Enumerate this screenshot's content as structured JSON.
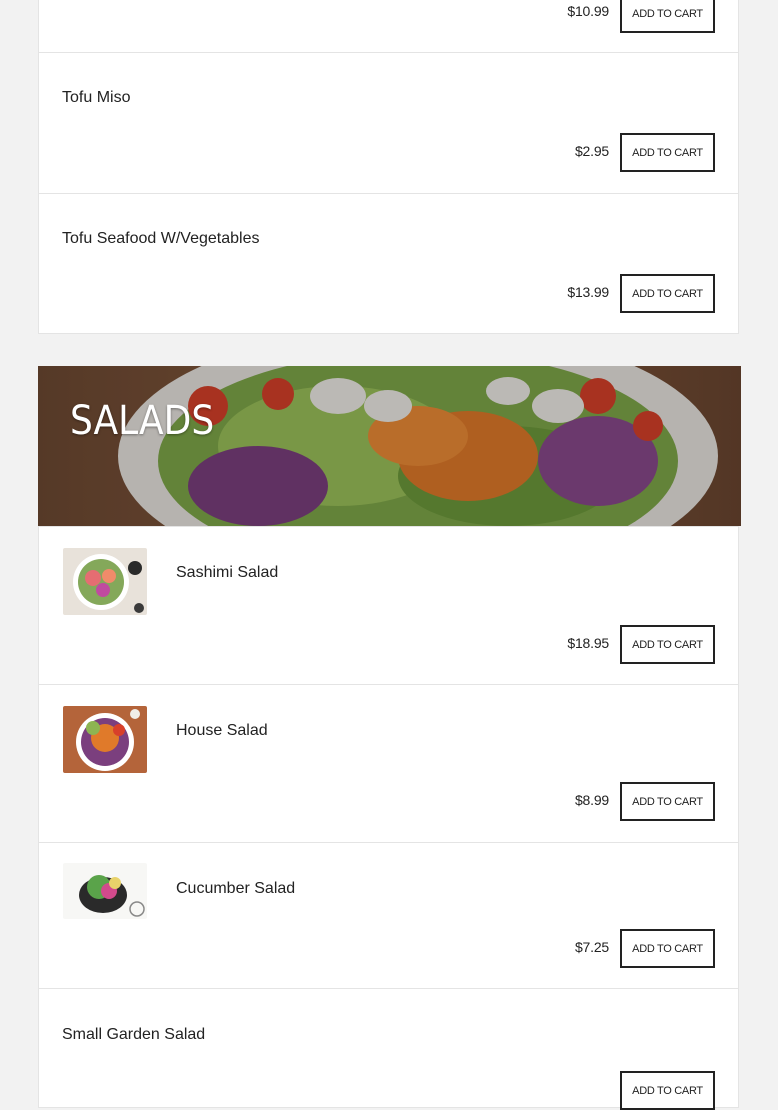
{
  "button_label": "ADD TO CART",
  "previous_items": [
    {
      "name": "",
      "price": "$10.99"
    },
    {
      "name": "Tofu Miso",
      "price": "$2.95"
    },
    {
      "name": "Tofu Seafood W/Vegetables",
      "price": "$13.99"
    }
  ],
  "section": {
    "title": "SALADS",
    "items": [
      {
        "name": "Sashimi Salad",
        "price": "$18.95"
      },
      {
        "name": "House Salad",
        "price": "$8.99"
      },
      {
        "name": "Cucumber Salad",
        "price": "$7.25"
      },
      {
        "name": "Small Garden Salad",
        "price": ""
      }
    ]
  }
}
